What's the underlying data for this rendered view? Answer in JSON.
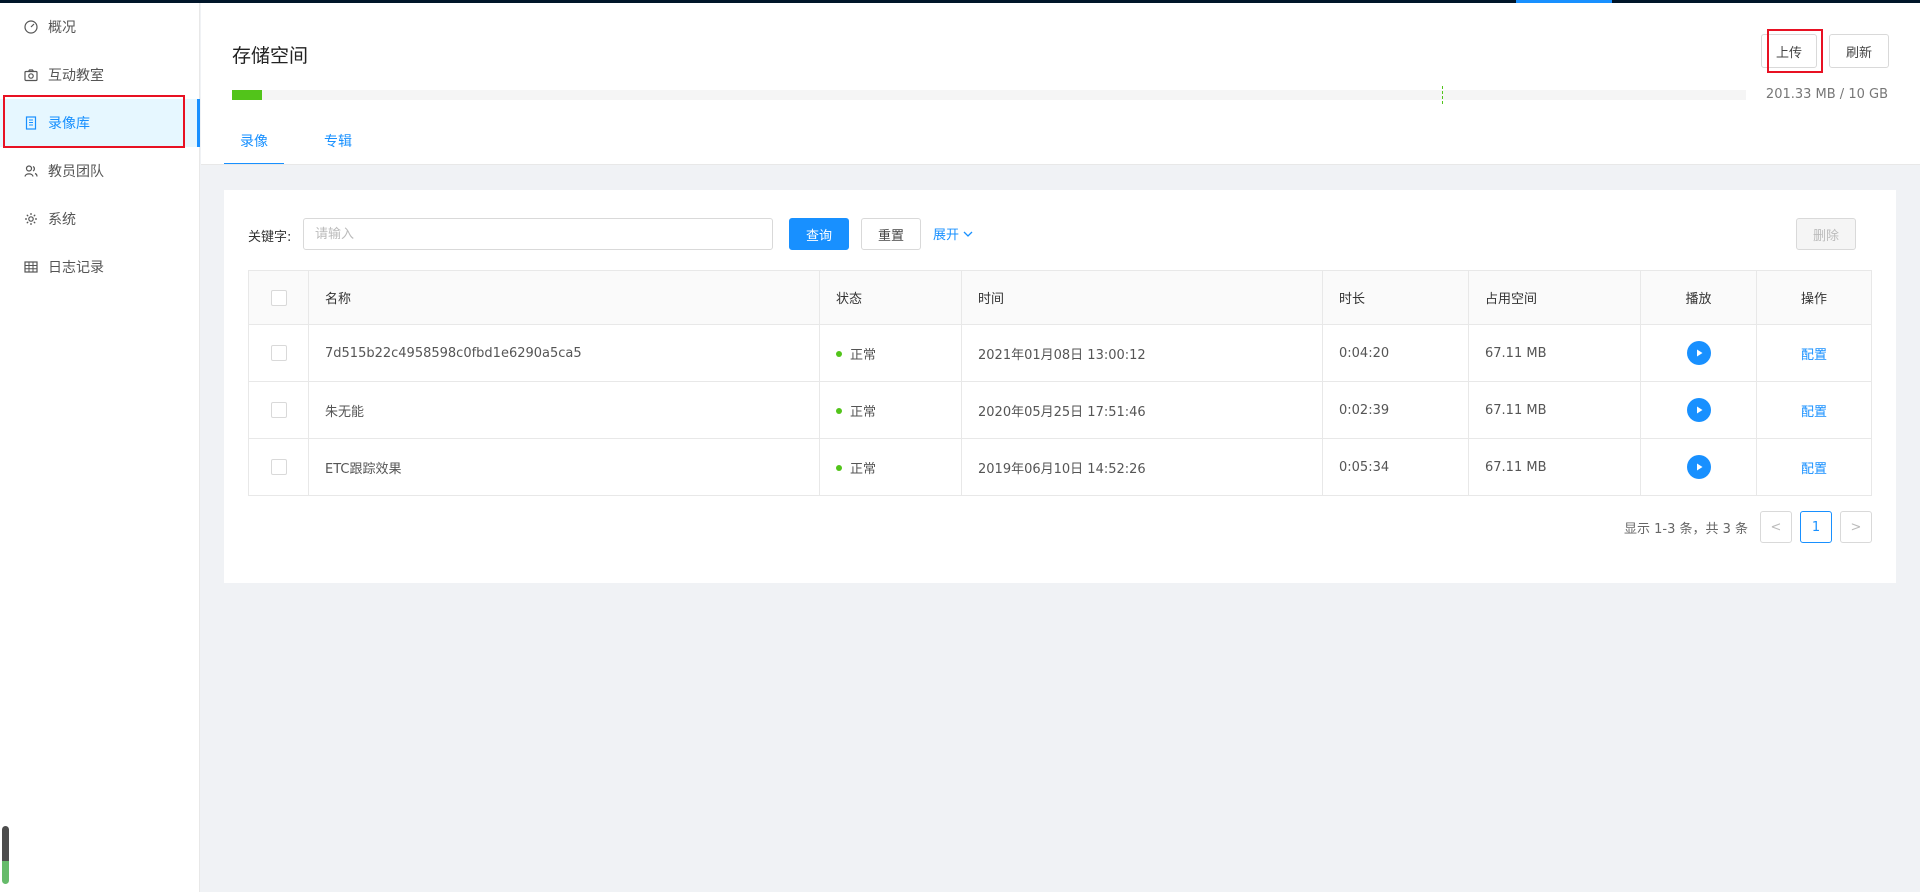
{
  "sidebar": {
    "items": [
      {
        "label": "概况",
        "icon": "dashboard-icon"
      },
      {
        "label": "互动教室",
        "icon": "camera-icon"
      },
      {
        "label": "录像库",
        "icon": "book-icon",
        "active": true
      },
      {
        "label": "教员团队",
        "icon": "team-icon"
      },
      {
        "label": "系统",
        "icon": "gear-icon"
      },
      {
        "label": "日志记录",
        "icon": "table-icon"
      }
    ]
  },
  "header": {
    "title": "存储空间",
    "upload_label": "上传",
    "refresh_label": "刷新",
    "storage_text": "201.33 MB / 10 GB",
    "storage_used_fraction": 0.02,
    "tabs": [
      {
        "label": "录像",
        "active": true
      },
      {
        "label": "专辑",
        "active": false
      }
    ]
  },
  "filter": {
    "keyword_label": "关键字:",
    "keyword_placeholder": "请输入",
    "keyword_value": "",
    "query_label": "查询",
    "reset_label": "重置",
    "expand_label": "展开",
    "delete_label": "删除"
  },
  "table": {
    "columns": [
      "名称",
      "状态",
      "时间",
      "时长",
      "占用空间",
      "播放",
      "操作"
    ],
    "rows": [
      {
        "name": "7d515b22c4958598c0fbd1e6290a5ca5",
        "status": "正常",
        "time": "2021年01月08日 13:00:12",
        "duration": "0:04:20",
        "size": "67.11 MB",
        "action": "配置"
      },
      {
        "name": "朱无能",
        "status": "正常",
        "time": "2020年05月25日 17:51:46",
        "duration": "0:02:39",
        "size": "67.11 MB",
        "action": "配置"
      },
      {
        "name": "ETC跟踪效果",
        "status": "正常",
        "time": "2019年06月10日 14:52:26",
        "duration": "0:05:34",
        "size": "67.11 MB",
        "action": "配置"
      }
    ]
  },
  "pagination": {
    "info": "显示 1-3 条，共 3 条",
    "current": "1",
    "prev": "<",
    "next": ">"
  },
  "colors": {
    "primary": "#1890ff",
    "success": "#52c41a",
    "highlight_box": "#e81123"
  }
}
